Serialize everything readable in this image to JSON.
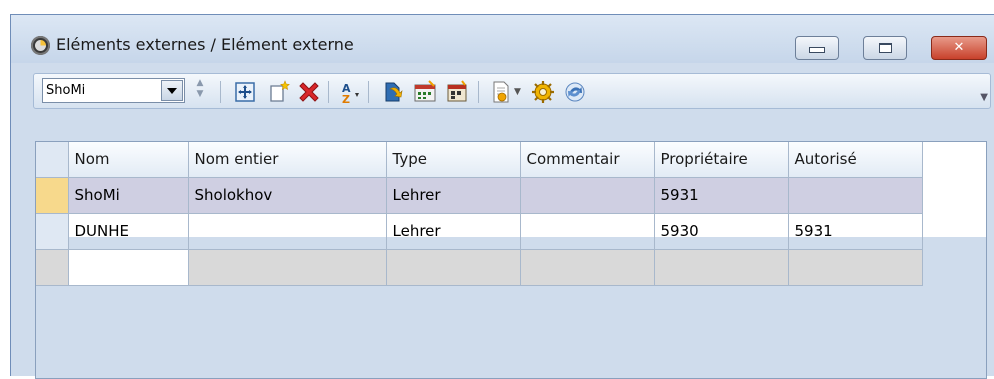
{
  "window": {
    "title": "Eléments externes / Elément externe"
  },
  "toolbar": {
    "combo_value": "ShoMi",
    "buttons": [
      {
        "icon": "cross-move-icon"
      },
      {
        "icon": "new-item-icon"
      },
      {
        "icon": "delete-icon"
      },
      {
        "icon": "sort-az-icon"
      },
      {
        "icon": "import-icon"
      },
      {
        "icon": "calendar-icon"
      },
      {
        "icon": "schedule-icon"
      },
      {
        "icon": "report-icon"
      },
      {
        "icon": "settings-gear-icon"
      },
      {
        "icon": "refresh-icon"
      }
    ]
  },
  "table": {
    "columns": [
      "Nom",
      "Nom entier",
      "Type",
      "Commentair",
      "Propriétaire",
      "Autorisé"
    ],
    "rows": [
      {
        "nom": "ShoMi",
        "nom_entier": "Sholokhov",
        "type": "Lehrer",
        "commentaire": "",
        "proprietaire": "5931",
        "autorise": ""
      },
      {
        "nom": "DUNHE",
        "nom_entier": "",
        "type": "Lehrer",
        "commentaire": "",
        "proprietaire": "5930",
        "autorise": "5931"
      }
    ]
  }
}
